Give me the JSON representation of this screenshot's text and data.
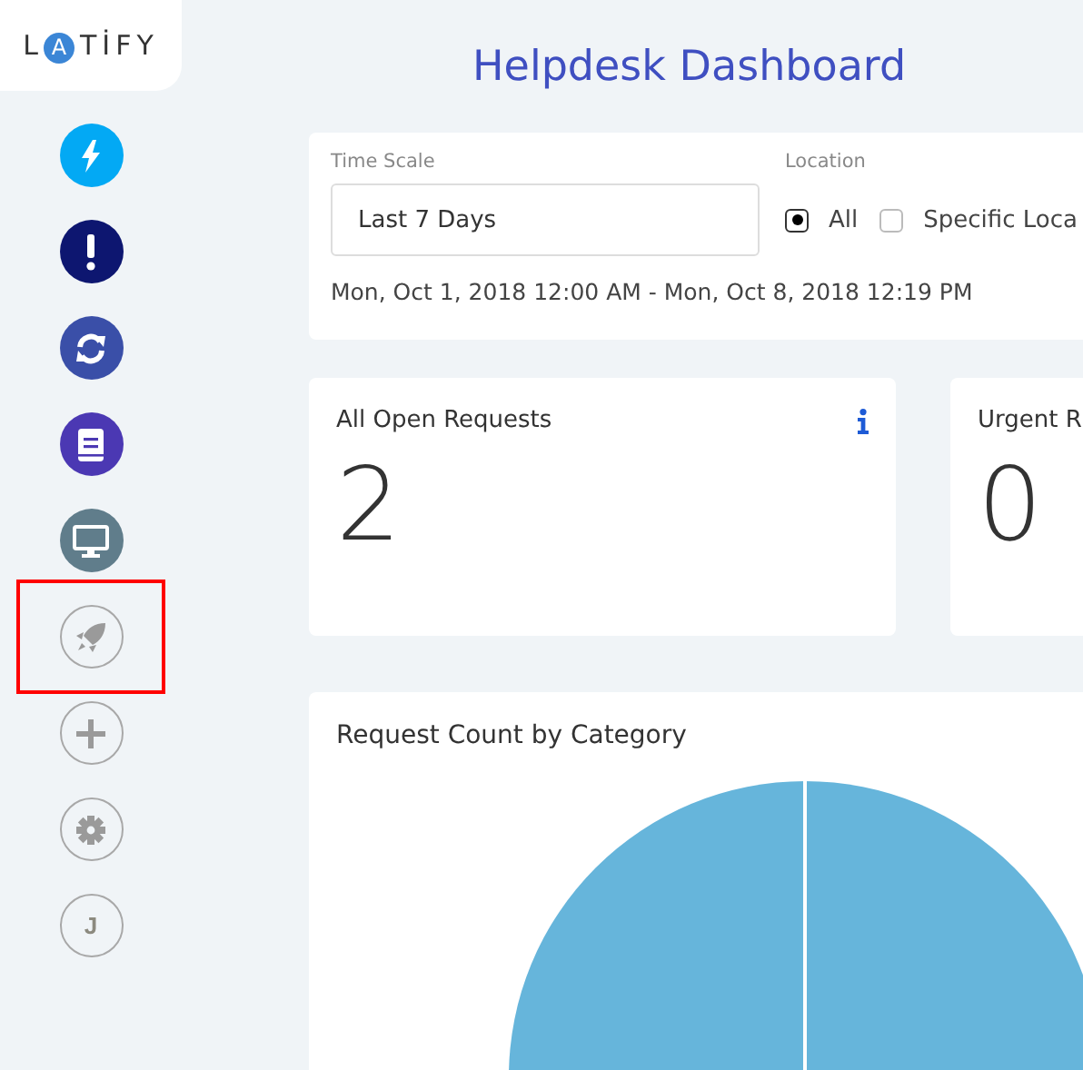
{
  "logo": {
    "text_before": "L",
    "accent_letter": "A",
    "text_after": "TİFY"
  },
  "sidebar": {
    "items": [
      {
        "kind": "bolt",
        "color": "#03a9f4",
        "highlighted": false
      },
      {
        "kind": "exclamation",
        "color": "#0d1670",
        "highlighted": false
      },
      {
        "kind": "sync",
        "color": "#3a4fa8",
        "highlighted": false
      },
      {
        "kind": "book",
        "color": "#4b38b3",
        "highlighted": false
      },
      {
        "kind": "monitor",
        "color": "#607d8b",
        "highlighted": false
      },
      {
        "kind": "rocket",
        "highlighted": true
      },
      {
        "kind": "plus",
        "highlighted": false
      },
      {
        "kind": "gear",
        "highlighted": false
      },
      {
        "kind": "letter",
        "label": "J",
        "highlighted": false
      }
    ]
  },
  "page_title": "Helpdesk Dashboard",
  "filters": {
    "time_scale": {
      "label": "Time Scale",
      "value": "Last 7 Days"
    },
    "location": {
      "label": "Location",
      "options": [
        {
          "label": "All",
          "selected": true
        },
        {
          "label": "Specific Loca",
          "selected": false
        }
      ]
    },
    "date_range": "Mon, Oct 1, 2018 12:00 AM - Mon, Oct 8, 2018 12:19 PM"
  },
  "stat_cards": [
    {
      "title": "All Open Requests",
      "value": "2",
      "info": true
    },
    {
      "title": "Urgent R",
      "value": "0"
    }
  ],
  "chart_card": {
    "title": "Request Count by Category"
  }
}
